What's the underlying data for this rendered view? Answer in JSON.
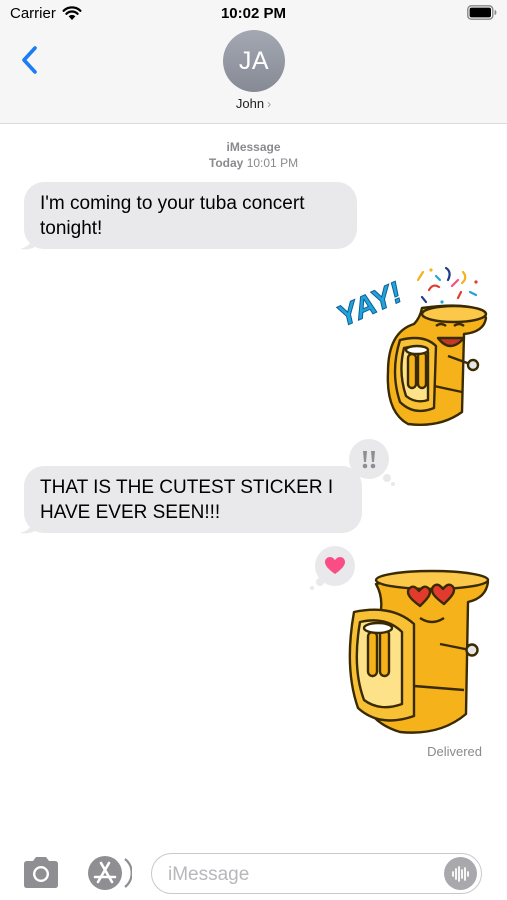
{
  "status_bar": {
    "carrier": "Carrier",
    "time": "10:02 PM",
    "wifi_icon": "wifi-icon",
    "battery_icon": "battery-icon"
  },
  "header": {
    "back_icon": "chevron-left-icon",
    "avatar_initials": "JA",
    "contact_name": "John",
    "contact_chevron": "›"
  },
  "conversation": {
    "service": "iMessage",
    "date_label": "Today",
    "time_label": "10:01 PM",
    "messages": [
      {
        "kind": "text",
        "direction": "incoming",
        "text": "I'm coming to your tuba concert tonight!"
      },
      {
        "kind": "sticker",
        "direction": "outgoing",
        "sticker": "happy-tuba-sticker",
        "caption": "YAY!"
      },
      {
        "kind": "text",
        "direction": "incoming",
        "text": "THAT IS THE CUTEST STICKER I HAVE EVER SEEN!!!",
        "tapback": "exclamation-icon"
      },
      {
        "kind": "sticker",
        "direction": "outgoing",
        "sticker": "heart-eyes-tuba-sticker",
        "tapback": "heart-icon"
      }
    ],
    "delivery_status": "Delivered"
  },
  "input_bar": {
    "camera_icon": "camera-icon",
    "apps_icon": "app-store-icon",
    "placeholder": "iMessage",
    "audio_icon": "audio-waveform-icon"
  },
  "colors": {
    "accent": "#1b7cf6",
    "bubble_incoming": "#e9e9eb",
    "header_bg": "#f6f6f7",
    "tuba_gold": "#f5b21b",
    "heart_red": "#e23b2e",
    "tapback_heart": "#fb4d85"
  }
}
